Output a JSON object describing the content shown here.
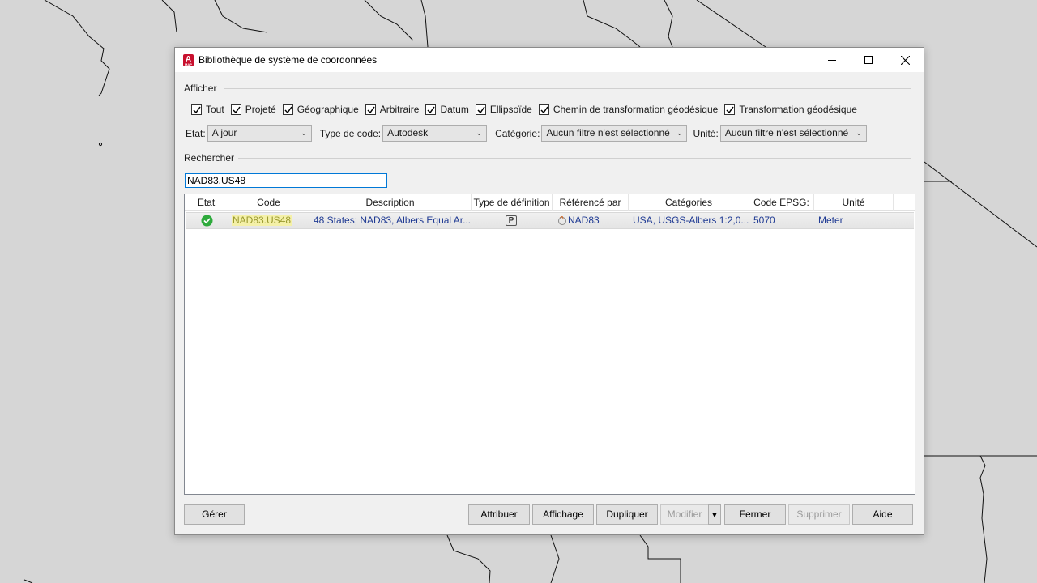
{
  "window": {
    "title": "Bibliothèque de système de coordonnées",
    "app_icon": "autocad-map-logo",
    "logo_letter": "A",
    "logo_sub": "MAP"
  },
  "afficher": {
    "label": "Afficher",
    "checkboxes": [
      {
        "label": "Tout",
        "checked": true
      },
      {
        "label": "Projeté",
        "checked": true
      },
      {
        "label": "Géographique",
        "checked": true
      },
      {
        "label": "Arbitraire",
        "checked": true
      },
      {
        "label": "Datum",
        "checked": true
      },
      {
        "label": "Ellipsoïde",
        "checked": true
      },
      {
        "label": "Chemin de transformation géodésique",
        "checked": true
      },
      {
        "label": "Transformation géodésique",
        "checked": true
      }
    ]
  },
  "filters": {
    "etat_label": "Etat:",
    "etat_value": "A jour",
    "type_code_label": "Type de code:",
    "type_code_value": "Autodesk",
    "categorie_label": "Catégorie:",
    "categorie_value": "Aucun filtre n'est sélectionné",
    "unite_label": "Unité:",
    "unite_value": "Aucun filtre n'est sélectionné"
  },
  "rechercher": {
    "label": "Rechercher",
    "value": "NAD83.US48"
  },
  "table": {
    "columns": [
      "Etat",
      "Code",
      "Description",
      "Type de définition",
      "Référencé par",
      "Catégories",
      "Code EPSG:",
      "Unité"
    ],
    "rows": [
      {
        "etat_icon": "check-circle-icon",
        "code": "NAD83.US48",
        "description": "48 States; NAD83, Albers Equal Ar...",
        "type_definition": "P",
        "reference_par": "NAD83",
        "categories": "USA, USGS-Albers 1:2,0...",
        "epsg": "5070",
        "unite": "Meter"
      }
    ]
  },
  "buttons": {
    "gerer": "Gérer",
    "attribuer": "Attribuer",
    "affichage": "Affichage",
    "dupliquer": "Dupliquer",
    "modifier": "Modifier",
    "fermer": "Fermer",
    "supprimer": "Supprimer",
    "aide": "Aide"
  },
  "colors": {
    "accent": "#0078d7",
    "logo": "#c8102e",
    "ok_green": "#2eaa3c",
    "highlight": "#f4f0a8"
  }
}
